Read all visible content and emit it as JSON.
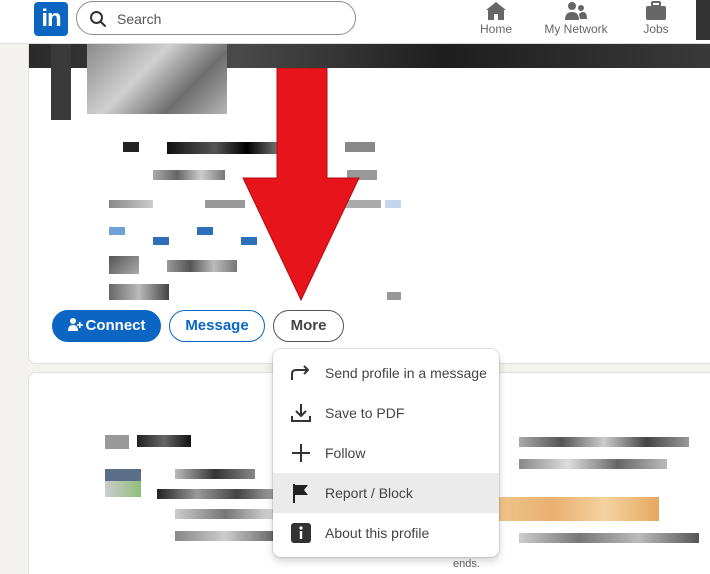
{
  "header": {
    "logo_text": "in",
    "search_placeholder": "Search",
    "nav": [
      {
        "label": "Home",
        "icon": "home-icon"
      },
      {
        "label": "My Network",
        "icon": "network-icon"
      },
      {
        "label": "Jobs",
        "icon": "jobs-icon"
      }
    ]
  },
  "profile": {
    "buttons": {
      "connect": "Connect",
      "message": "Message",
      "more": "More"
    }
  },
  "more_menu": {
    "items": [
      {
        "label": "Send profile in a message",
        "icon": "share-arrow-icon"
      },
      {
        "label": "Save to PDF",
        "icon": "download-icon"
      },
      {
        "label": "Follow",
        "icon": "plus-icon"
      },
      {
        "label": "Report / Block",
        "icon": "flag-icon"
      },
      {
        "label": "About this profile",
        "icon": "info-icon"
      }
    ],
    "highlighted_index": 3
  },
  "card2": {
    "footer_text": "ends."
  },
  "colors": {
    "brand": "#0a66c2",
    "annotation_arrow": "#e8141c"
  }
}
